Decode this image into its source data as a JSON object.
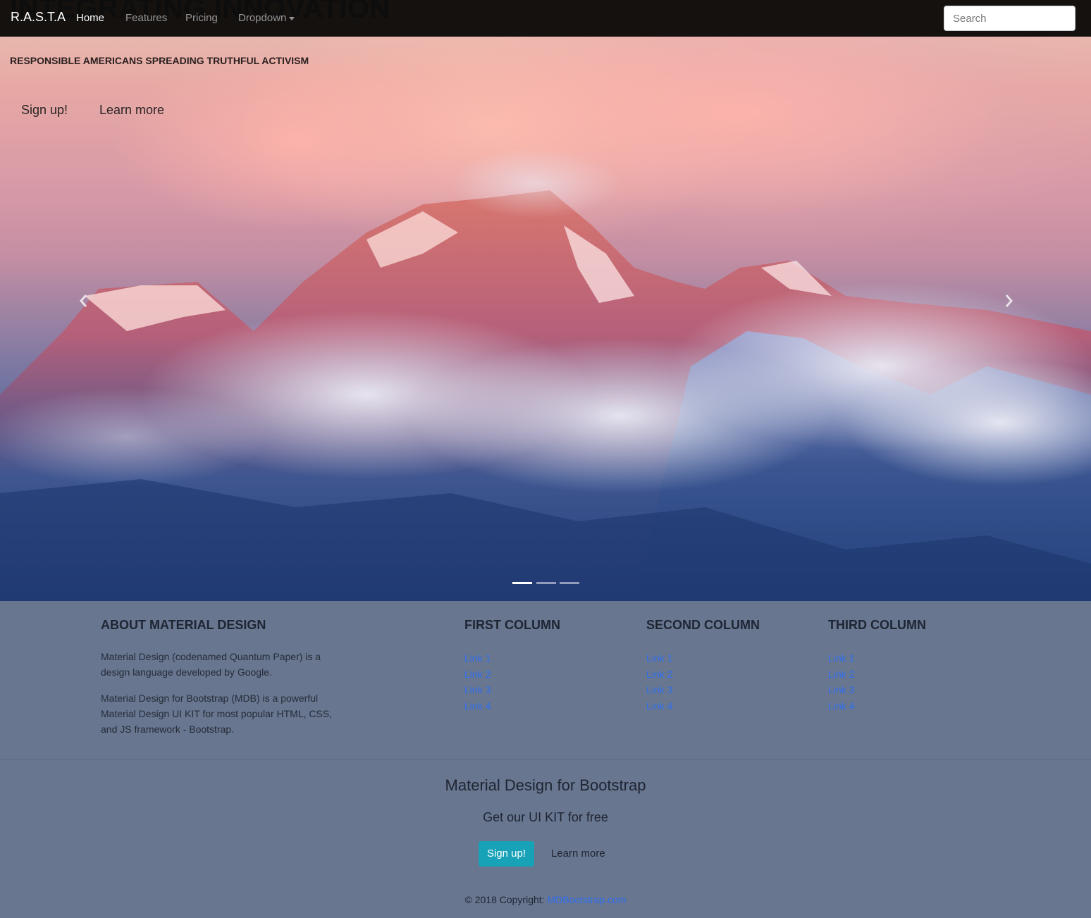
{
  "nav": {
    "brand": "R.A.S.T.A",
    "overlay_title": "INTEGRATING INNOVATION",
    "items": [
      {
        "label": "Home",
        "active": true
      },
      {
        "label": "Features",
        "active": false
      },
      {
        "label": "Pricing",
        "active": false
      },
      {
        "label": "Dropdown",
        "active": false
      }
    ],
    "search": {
      "placeholder": "Search",
      "value": ""
    }
  },
  "hero": {
    "tagline": "RESPONSIBLE AMERICANS SPREADING TRUTHFUL ACTIVISM",
    "signup_label": "Sign up!",
    "learn_label": "Learn more",
    "prev_icon": "chevron-left-icon",
    "next_icon": "chevron-right-icon",
    "indicators": [
      true,
      false,
      false
    ]
  },
  "footer": {
    "about": {
      "title": "ABOUT MATERIAL DESIGN",
      "p1": "Material Design (codenamed Quantum Paper) is a design language developed by Google.",
      "p2": "Material Design for Bootstrap (MDB) is a powerful Material Design UI KIT for most popular HTML, CSS, and JS framework - Bootstrap."
    },
    "columns": [
      {
        "title": "FIRST COLUMN",
        "links": [
          "Link 1",
          "Link 2",
          "Link 3",
          "Link 4"
        ]
      },
      {
        "title": "SECOND COLUMN",
        "links": [
          "Link 1",
          "Link 2",
          "Link 3",
          "Link 4"
        ]
      },
      {
        "title": "THIRD COLUMN",
        "links": [
          "Link 1",
          "Link 2",
          "Link 3",
          "Link 4"
        ]
      }
    ],
    "cta": {
      "title": "Material Design for Bootstrap",
      "subtitle": "Get our UI KIT for free",
      "signup_label": "Sign up!",
      "learn_label": "Learn more"
    },
    "copyright_text": "© 2018 Copyright: ",
    "copyright_link": "MDBootstrap.com"
  },
  "colors": {
    "navbar": "#14110f",
    "footer": "#68768f",
    "link": "#2f6ff0",
    "cta_button": "#17a2b8"
  }
}
